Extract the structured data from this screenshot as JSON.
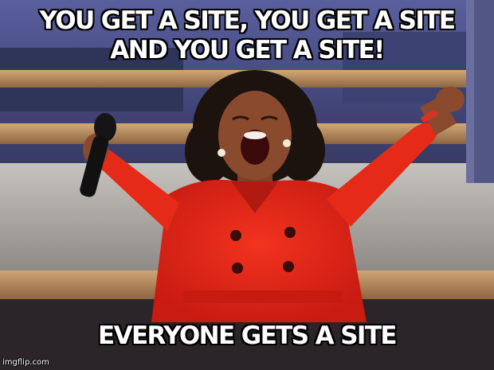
{
  "meme": {
    "top_text": "YOU GET A SITE, YOU GET A SITE AND YOU GET A SITE!",
    "bottom_text": "EVERYONE GETS A SITE",
    "watermark": "imgflip.com"
  },
  "colors": {
    "dress": "#e8241a",
    "skin": "#8a4a2e",
    "hair": "#1c130f",
    "stage_wood": "#b58a5c",
    "backdrop": "#4a4e8c"
  }
}
